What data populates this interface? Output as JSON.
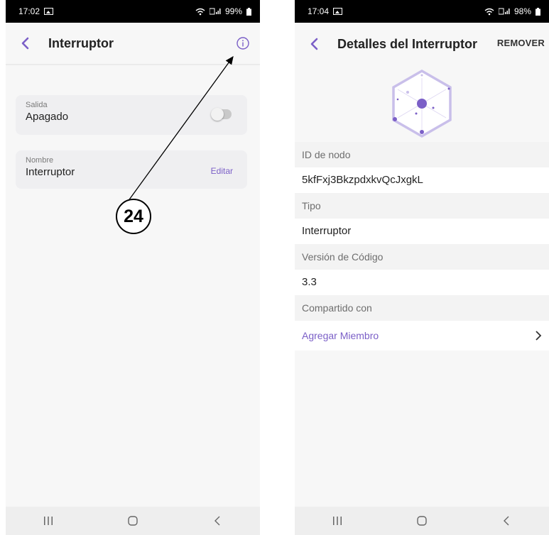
{
  "left_screen": {
    "status": {
      "time": "17:02",
      "battery": "99%"
    },
    "appbar": {
      "title": "Interruptor"
    },
    "output_card": {
      "label": "Salida",
      "value": "Apagado",
      "toggle_on": false
    },
    "name_card": {
      "label": "Nombre",
      "value": "Interruptor",
      "edit_label": "Editar"
    },
    "icons": [
      "back-icon",
      "info-icon"
    ]
  },
  "right_screen": {
    "status": {
      "time": "17:04",
      "battery": "98%"
    },
    "appbar": {
      "title": "Detalles del Interruptor",
      "remove_label": "REMOVER"
    },
    "fields": [
      {
        "label": "ID de nodo",
        "value": "5kfFxj3BkzpdxkvQcJxgkL"
      },
      {
        "label": "Tipo",
        "value": "Interruptor"
      },
      {
        "label": "Versión de Código",
        "value": "3.3"
      }
    ],
    "shared": {
      "label": "Compartido con",
      "add_member_label": "Agregar Miembro"
    }
  },
  "annotation": {
    "number": "24"
  },
  "colors": {
    "accent": "#7b5fc7",
    "status_bar": "#000000"
  }
}
